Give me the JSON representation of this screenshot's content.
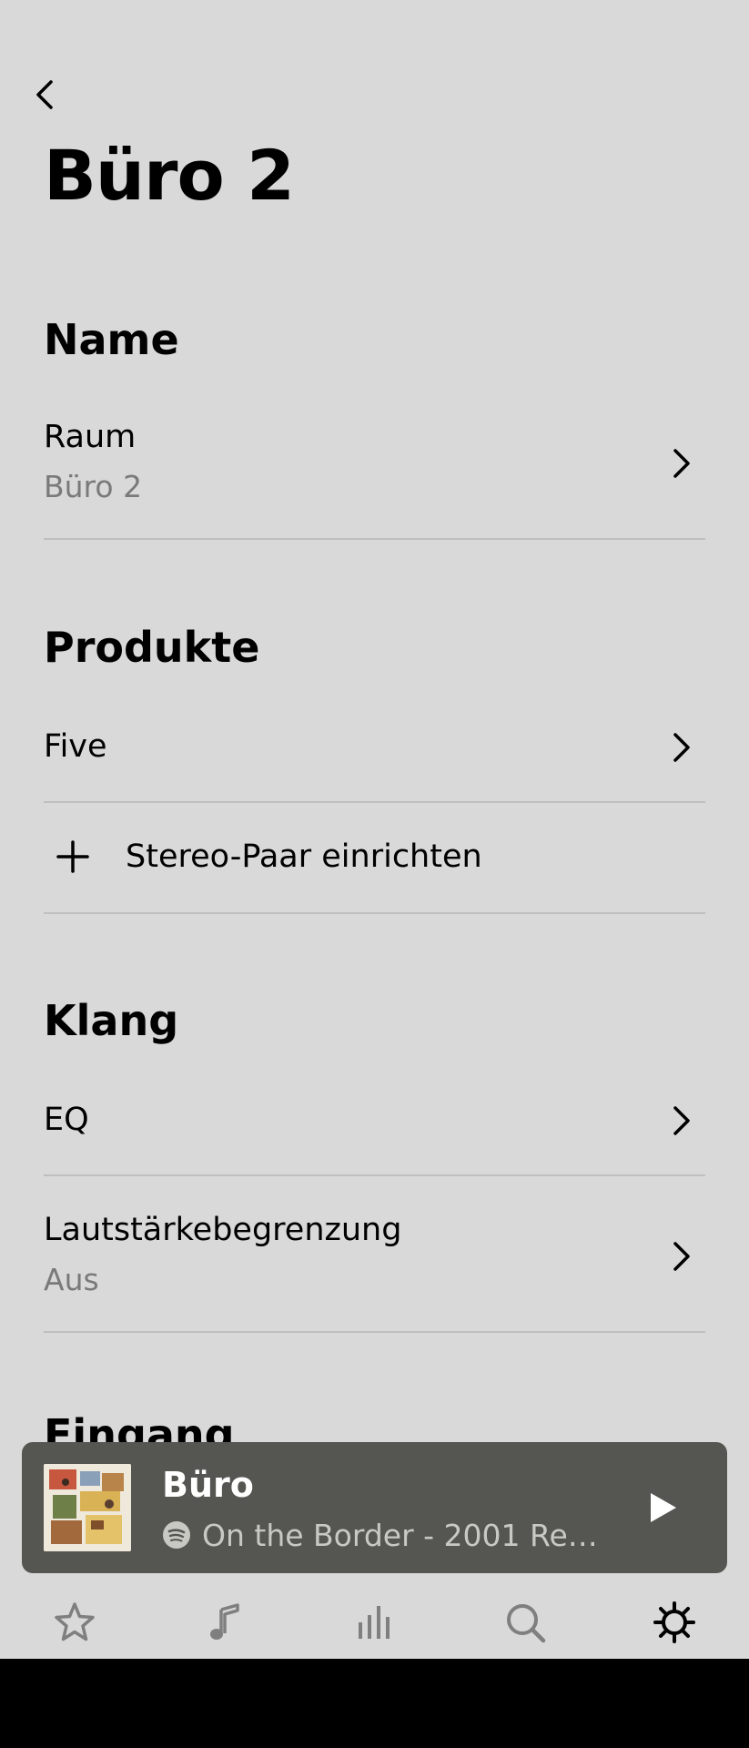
{
  "header": {
    "title": "Büro 2"
  },
  "sections": {
    "name": {
      "title": "Name",
      "room_label": "Raum",
      "room_value": "Büro 2"
    },
    "products": {
      "title": "Produkte",
      "item_label": "Five",
      "add_label": "Stereo-Paar einrichten"
    },
    "sound": {
      "title": "Klang",
      "eq_label": "EQ",
      "volume_label": "Lautstärkebegrenzung",
      "volume_value": "Aus"
    },
    "input": {
      "title": "Eingang"
    }
  },
  "now_playing": {
    "room": "Büro",
    "track": "On the Border - 2001 Rem…",
    "service_icon": "spotify-icon"
  },
  "tabs": [
    {
      "icon": "star-icon",
      "active": false
    },
    {
      "icon": "music-note-icon",
      "active": false
    },
    {
      "icon": "rooms-bars-icon",
      "active": false
    },
    {
      "icon": "search-icon",
      "active": false
    },
    {
      "icon": "gear-icon",
      "active": true
    }
  ],
  "colors": {
    "background": "#d9d9d9",
    "now_playing_bg": "#555651",
    "secondary_text": "#7a7a7a",
    "inactive_icon": "#7f7f7f",
    "divider": "#bfbfbf"
  }
}
